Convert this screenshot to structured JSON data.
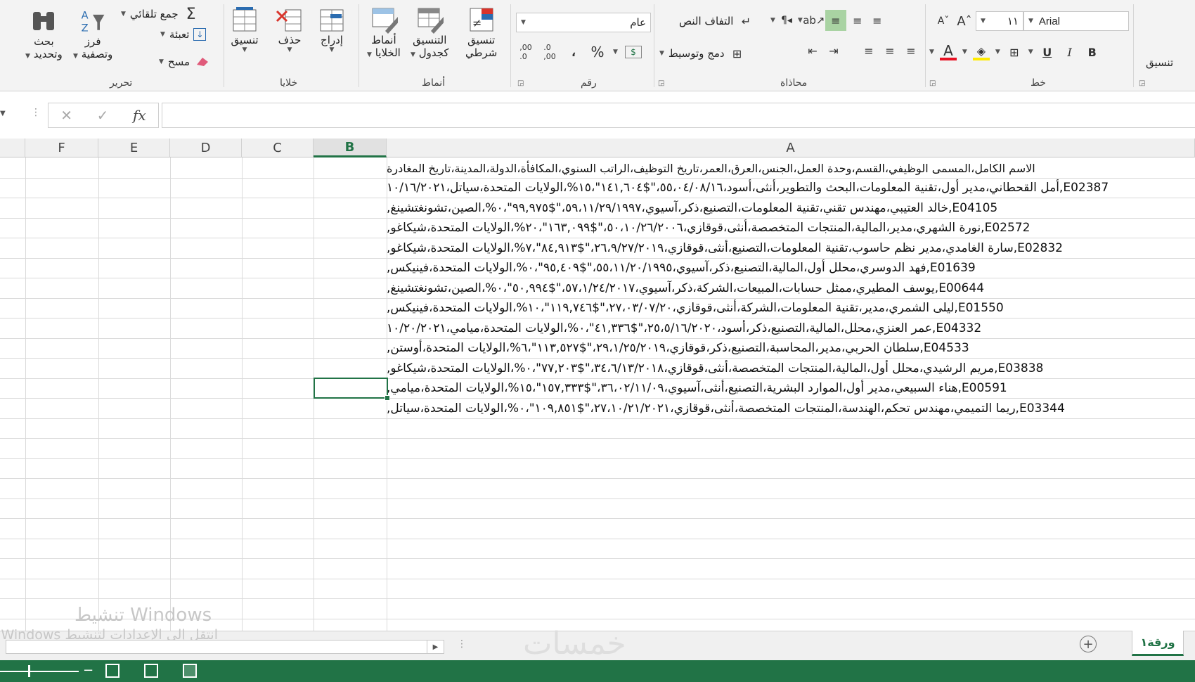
{
  "ribbon": {
    "editing": {
      "group_label": "تحرير",
      "find_select": [
        "بحث",
        "وتحديد"
      ],
      "sort_filter": [
        "فرز",
        "وتصفية"
      ],
      "autosum": "جمع تلقائي",
      "fill": "تعبئة",
      "clear": "مسح"
    },
    "cells": {
      "group_label": "خلايا",
      "format": "تنسيق",
      "delete": "حذف",
      "insert": "إدراج"
    },
    "styles": {
      "group_label": "أنماط",
      "cell_styles": [
        "أنماط",
        "الخلايا"
      ],
      "format_as_table": [
        "التنسيق",
        "كجدول"
      ],
      "conditional_formatting": [
        "تنسيق",
        "شرطي"
      ]
    },
    "number": {
      "group_label": "رقم",
      "format_value": "عام",
      "percent": "%",
      "comma": "،",
      "currency": "$"
    },
    "alignment": {
      "group_label": "محاذاة",
      "wrap_text": "التفاف النص",
      "merge_center": "دمج وتوسيط"
    },
    "font": {
      "group_label": "خط",
      "font_name": "Arial",
      "font_size": "١١",
      "bold": "B",
      "italic": "I",
      "underline": "U"
    },
    "clipboard_partial": "تنسيق"
  },
  "formula_bar": {
    "fx": "fx",
    "cancel": "✕",
    "enter": "✓",
    "value": ""
  },
  "grid": {
    "columns": [
      "F",
      "E",
      "D",
      "C",
      "B",
      "A"
    ],
    "selected_column": "B",
    "rows": [
      "الاسم الكامل،المسمى الوظيفي،القسم،وحدة العمل،الجنس،العرق،العمر،تاريخ التوظيف،الراتب السنوي،المكافأة،الدولة،المدينة،تاريخ المغادرة",
      "E02387,أمل القحطاني،مدير أول،تقنية المعلومات،البحث والتطوير،أنثى،أسود،٥٥،٠٤/٠٨/١٦،\"$١٤١,٦٠٤\"،١٥%،الولايات المتحدة،سياتل،١٠/١٦/٢٠٢١",
      "E04105,خالد العتيبي،مهندس تقني،تقنية المعلومات،التصنيع،ذكر،آسيوي،٥٩،١١/٢٩/١٩٩٧،\"$٩٩,٩٧٥\"،٠%،الصين،تشونغتشينغ,",
      "E02572,نورة الشهري،مدير،المالية،المنتجات المتخصصة،أنثى،قوقازي،٥٠،١٠/٢٦/٢٠٠٦،\"$١٦٣,٠٩٩\"،٢٠%،الولايات المتحدة،شيكاغو,",
      "E02832,سارة الغامدي،مدير نظم حاسوب،تقنية المعلومات،التصنيع،أنثى،قوقازي،٢٦،٩/٢٧/٢٠١٩،\"$٨٤,٩١٣\"،٧%،الولايات المتحدة،شيكاغو,",
      "E01639,فهد الدوسري،محلل أول،المالية،التصنيع،ذكر،آسيوي،٥٥،١١/٢٠/١٩٩٥،\"$٩٥,٤٠٩\"،٠%،الولايات المتحدة،فينيكس,",
      "E00644,يوسف المطيري،ممثل حسابات،المبيعات،الشركة،ذكر،آسيوي،٥٧،١/٢٤/٢٠١٧،\"$٥٠,٩٩٤\"،٠%،الصين،تشونغتشينغ,",
      "E01550,ليلى الشمري،مدير،تقنية المعلومات،الشركة،أنثى،قوقازي،٢٧،٠٣/٠٧/٢٠،\"$١١٩,٧٤٦\"،١٠%،الولايات المتحدة،فينيكس,",
      "E04332,عمر العنزي،محلل،المالية،التصنيع،ذكر،أسود،٢٥،٥/١٦/٢٠٢٠،\"$٤١,٣٣٦\"،٠%،الولايات المتحدة،ميامي،١٠/٢٠/٢٠٢١",
      "E04533,سلطان الحربي،مدير،المحاسبة،التصنيع،ذكر،قوقازي،٢٩،١/٢٥/٢٠١٩،\"$١١٣,٥٢٧\"،٦%،الولايات المتحدة،أوستن,",
      "E03838,مريم الرشيدي،محلل أول،المالية،المنتجات المتخصصة،أنثى،قوقازي،٣٤،٦/١٣/٢٠١٨،\"$٧٧,٢٠٣\"،٠%،الولايات المتحدة،شيكاغو,",
      "E00591,هناء السبيعي،مدير أول،الموارد البشرية،التصنيع،أنثى،آسيوي،٣٦،٠٢/١١/٠٩،\"$١٥٧,٣٣٣\"،١٥%،الولايات المتحدة،ميامي,",
      "E03344,ريما التميمي،مهندس تحكم،الهندسة،المنتجات المتخصصة،أنثى،قوقازي،٢٧،١٠/٢١/٢٠٢١،\"$١٠٩,٨٥١\"،٠%،الولايات المتحدة،سياتل,"
    ]
  },
  "sheet_tab": "ورقة١",
  "activation_watermark": {
    "title": "تنشيط Windows",
    "subtitle": "انتقل إلى الإعدادات لتنشيط Windows"
  },
  "site_watermark": "خمسات",
  "colors": {
    "accent": "#217346",
    "font_color": "#e81123",
    "highlight": "#ffeb00"
  }
}
